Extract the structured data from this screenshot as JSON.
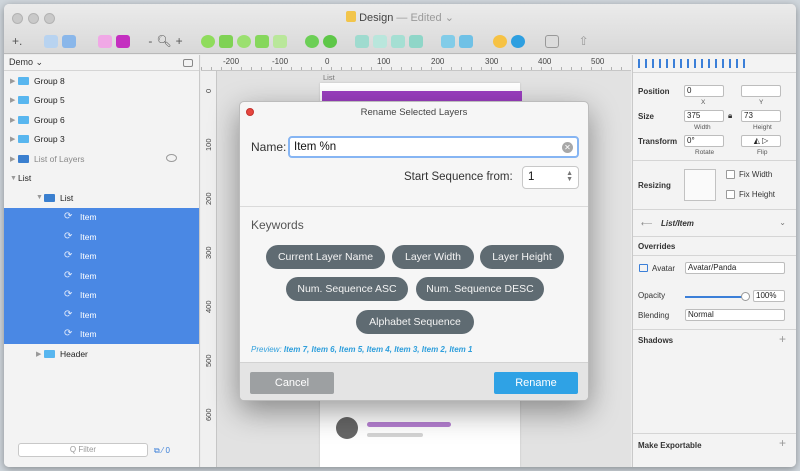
{
  "window": {
    "title": "Design",
    "edited": "— Edited",
    "edited_arrow": "⌄"
  },
  "toolbar": {
    "insert": "+.",
    "zoom_minus": "-",
    "zoom_plus": "+"
  },
  "left_panel": {
    "page": "Demo ⌄",
    "layers": [
      {
        "label": "Group 8",
        "selected": false
      },
      {
        "label": "Group 5",
        "selected": false
      },
      {
        "label": "Group 6",
        "selected": false
      },
      {
        "label": "Group 3",
        "selected": false
      },
      {
        "label": "List of Layers",
        "selected": false
      },
      {
        "label": "List",
        "selected": false
      },
      {
        "label": "List",
        "selected": false
      },
      {
        "label": "Item",
        "selected": true
      },
      {
        "label": "Item",
        "selected": true
      },
      {
        "label": "Item",
        "selected": true
      },
      {
        "label": "Item",
        "selected": true
      },
      {
        "label": "Item",
        "selected": true
      },
      {
        "label": "Item",
        "selected": true
      },
      {
        "label": "Item",
        "selected": true
      },
      {
        "label": "Header",
        "selected": false
      }
    ],
    "filter_placeholder": "Q Filter",
    "filter_tools": "⧉ ⁄ 0"
  },
  "rulers": {
    "h_ticks": [
      "-200",
      "-100",
      "0",
      "100",
      "200",
      "300",
      "400",
      "500"
    ],
    "v_ticks": [
      "0",
      "100",
      "200",
      "300",
      "400",
      "500",
      "600"
    ]
  },
  "artboard": {
    "label": "List"
  },
  "inspector": {
    "position_label": "Position",
    "position_x": "0",
    "position_y": "",
    "x_label": "X",
    "y_label": "Y",
    "size_label": "Size",
    "width": "375",
    "height": "73",
    "width_label": "Width",
    "height_label": "Height",
    "transform_label": "Transform",
    "rotate": "0°",
    "rotate_label": "Rotate",
    "flip_label": "Flip",
    "resizing_label": "Resizing",
    "fix_width": "Fix Width",
    "fix_height": "Fix Height",
    "symbol": "List/Item",
    "overrides_label": "Overrides",
    "avatar_label": "Avatar",
    "avatar_value": "Avatar/Panda",
    "opacity_label": "Opacity",
    "opacity_value": "100%",
    "blending_label": "Blending",
    "blending_value": "Normal",
    "shadows_label": "Shadows",
    "make_exportable": "Make Exportable"
  },
  "modal": {
    "title": "Rename Selected Layers",
    "name_label": "Name:",
    "name_value": "Item %n",
    "seq_label": "Start Sequence from:",
    "seq_value": "1",
    "keywords_label": "Keywords",
    "keywords": [
      "Current Layer Name",
      "Layer Width",
      "Layer Height",
      "Num. Sequence ASC",
      "Num. Sequence DESC",
      "Alphabet Sequence"
    ],
    "preview_label": "Preview:",
    "preview_value": "Item 7, Item 6, Item 5, Item 4, Item 3, Item 2, Item 1",
    "cancel": "Cancel",
    "rename": "Rename"
  }
}
